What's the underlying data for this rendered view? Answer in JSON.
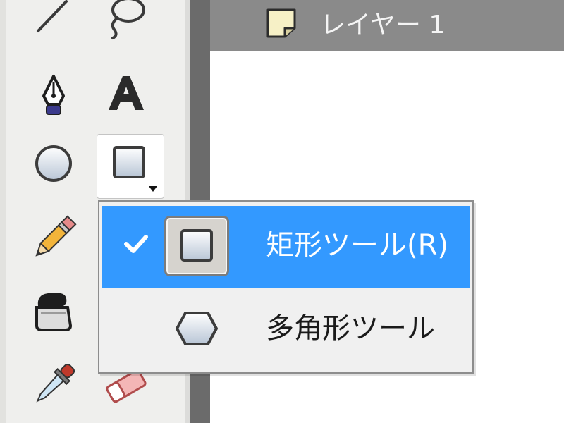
{
  "timeline": {
    "layer_name": "レイヤー 1"
  },
  "toolbar": {
    "tools": [
      {
        "name": "line-tool",
        "icon": "line-icon"
      },
      {
        "name": "lasso-tool",
        "icon": "lasso-icon"
      },
      {
        "name": "pen-tool",
        "icon": "pen-nib-icon"
      },
      {
        "name": "text-tool",
        "icon": "text-a-icon",
        "glyph": "A"
      },
      {
        "name": "oval-tool",
        "icon": "circle-icon"
      },
      {
        "name": "rectangle-tool",
        "icon": "rectangle-icon",
        "selected": true
      },
      {
        "name": "pencil-tool",
        "icon": "pencil-icon"
      },
      {
        "name": "ink-bottle-tool",
        "icon": "ink-bottle-icon"
      },
      {
        "name": "eyedropper-tool",
        "icon": "eyedropper-icon"
      },
      {
        "name": "eraser-tool",
        "icon": "eraser-icon"
      }
    ]
  },
  "shape_menu": {
    "items": [
      {
        "label": "矩形ツール(R)",
        "icon": "rectangle-icon",
        "checked": true,
        "highlighted": true
      },
      {
        "label": "多角形ツール",
        "icon": "hexagon-icon",
        "checked": false,
        "highlighted": false
      }
    ]
  },
  "colors": {
    "highlight": "#3399ff",
    "timeline_bar": "#8a8a8a",
    "splitter": "#6b6b6b",
    "toolbar_bg": "#efefed"
  }
}
